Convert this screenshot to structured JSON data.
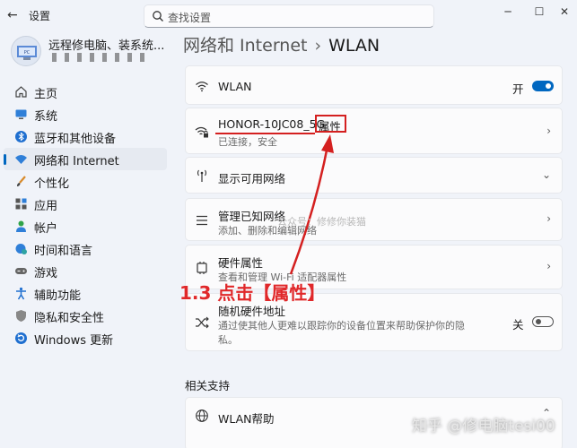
{
  "window": {
    "title": "设置",
    "back_icon": "back-arrow-icon",
    "search_placeholder": "查找设置",
    "controls": [
      "minimize",
      "maximize",
      "close"
    ]
  },
  "profile": {
    "name": "远程修电脑、装系统..."
  },
  "sidebar": {
    "items": [
      {
        "label": "主页",
        "icon": "home-icon"
      },
      {
        "label": "系统",
        "icon": "monitor-icon"
      },
      {
        "label": "蓝牙和其他设备",
        "icon": "bluetooth-icon"
      },
      {
        "label": "网络和 Internet",
        "icon": "wifi-icon",
        "active": true
      },
      {
        "label": "个性化",
        "icon": "brush-icon"
      },
      {
        "label": "应用",
        "icon": "apps-icon"
      },
      {
        "label": "帐户",
        "icon": "person-icon"
      },
      {
        "label": "时间和语言",
        "icon": "globe-clock-icon"
      },
      {
        "label": "游戏",
        "icon": "gamepad-icon"
      },
      {
        "label": "辅助功能",
        "icon": "accessibility-icon"
      },
      {
        "label": "隐私和安全性",
        "icon": "shield-icon"
      },
      {
        "label": "Windows 更新",
        "icon": "update-icon"
      }
    ]
  },
  "breadcrumb": {
    "parent": "网络和 Internet",
    "separator": "›",
    "current": "WLAN"
  },
  "wlan_toggle": {
    "label": "WLAN",
    "state_label": "开",
    "on": true
  },
  "network": {
    "name": "HONOR-10JC08_5G",
    "properties_label": "属性",
    "status": "已连接，安全"
  },
  "show_networks": {
    "label": "显示可用网络"
  },
  "manage_known": {
    "label": "管理已知网络",
    "description": "添加、删除和编辑网络"
  },
  "hardware": {
    "label": "硬件属性",
    "description": "查看和管理 Wi-Fi 适配器属性"
  },
  "random_hw": {
    "label": "随机硬件地址",
    "description_line1": "通过使其他人更难以跟踪你的设备位置来帮助保护你的隐",
    "description_line2": "私。",
    "state_label": "关",
    "on": false
  },
  "related": {
    "heading": "相关支持",
    "wlan_help": "WLAN帮助"
  },
  "annotation": {
    "text": "1.3 点击【属性】",
    "color": "#e0282a"
  },
  "watermarks": {
    "middle": "公众号：修修你装猫",
    "bottom_right": "知乎 @修电脑tesi00"
  },
  "colors": {
    "accent": "#0067c0",
    "annotation_red": "#d42020"
  }
}
